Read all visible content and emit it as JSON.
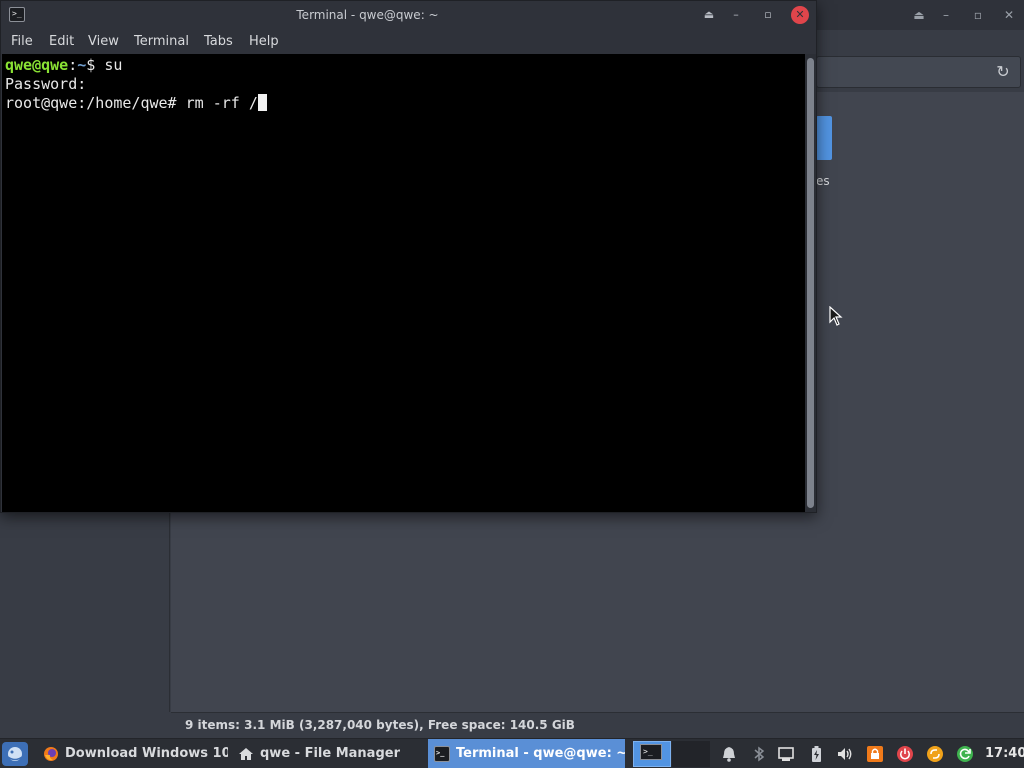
{
  "file_manager": {
    "folder_label_fragment": "es",
    "status_text": "9 items: 3.1 MiB (3,287,040 bytes), Free space: 140.5 GiB",
    "window_controls": [
      "⏏",
      "–",
      "▫",
      "✕"
    ]
  },
  "terminal": {
    "title": "Terminal - qwe@qwe: ~",
    "icon_glyph": ">_",
    "window_controls": {
      "eject": "⏏",
      "minimize": "–",
      "maximize": "▫",
      "close": "✕"
    },
    "menu": {
      "file": "File",
      "edit": "Edit",
      "view": "View",
      "terminal": "Terminal",
      "tabs": "Tabs",
      "help": "Help"
    },
    "lines": {
      "line1_user": "qwe@qwe",
      "line1_sep": ":",
      "line1_path": "~",
      "line1_cmd": "$ su",
      "line2": "Password:",
      "line3": "root@qwe:/home/qwe# rm -rf /"
    }
  },
  "taskbar": {
    "tasks": {
      "firefox": "Download Windows 10 ...",
      "file_manager": "qwe - File Manager",
      "terminal": "Terminal - qwe@qwe: ~"
    },
    "workspace_glyph": ">_",
    "clock": "17:40",
    "tray_icons": [
      "bell-icon",
      "bluetooth-icon",
      "network-icon",
      "battery-icon",
      "volume-icon",
      "lock-icon",
      "power-icon",
      "update-icon",
      "refresh-icon"
    ],
    "colors": {
      "active_task": "#5a8fd6",
      "close_button": "#e0454b",
      "prompt_user": "#8ae234",
      "prompt_path": "#729fcf"
    }
  }
}
